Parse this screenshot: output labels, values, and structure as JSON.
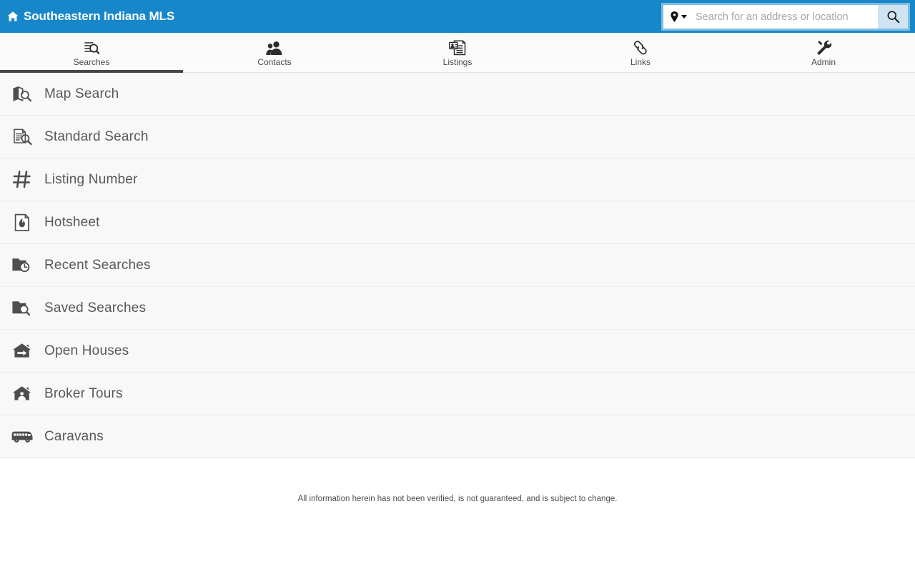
{
  "header": {
    "brand_title": "Southeastern Indiana MLS",
    "brand_icon": "home-icon",
    "accent_color": "#1787c9"
  },
  "search": {
    "placeholder": "Search for an address or location",
    "value": "",
    "geo_icon": "map-pin-icon",
    "geo_caret_icon": "caret-down-icon",
    "submit_icon": "magnifier-icon",
    "button_color": "#cfe3f2"
  },
  "tabs": [
    {
      "label": "Searches",
      "icon": "document-search-icon",
      "active": true
    },
    {
      "label": "Contacts",
      "icon": "people-icon",
      "active": false
    },
    {
      "label": "Listings",
      "icon": "listing-card-icon",
      "active": false
    },
    {
      "label": "Links",
      "icon": "chain-link-icon",
      "active": false
    },
    {
      "label": "Admin",
      "icon": "wrench-icon",
      "active": false
    }
  ],
  "menu": {
    "items": [
      {
        "label": "Map Search",
        "icon": "map-search-icon"
      },
      {
        "label": "Standard Search",
        "icon": "document-search-icon"
      },
      {
        "label": "Listing Number",
        "icon": "hash-icon"
      },
      {
        "label": "Hotsheet",
        "icon": "flame-document-icon"
      },
      {
        "label": "Recent Searches",
        "icon": "folder-clock-icon"
      },
      {
        "label": "Saved Searches",
        "icon": "folder-search-icon"
      },
      {
        "label": "Open Houses",
        "icon": "house-arrow-icon"
      },
      {
        "label": "Broker Tours",
        "icon": "house-person-icon"
      },
      {
        "label": "Caravans",
        "icon": "bus-icon"
      }
    ]
  },
  "footer": {
    "disclaimer": "All information herein has not been verified, is not guaranteed, and is subject to change."
  }
}
